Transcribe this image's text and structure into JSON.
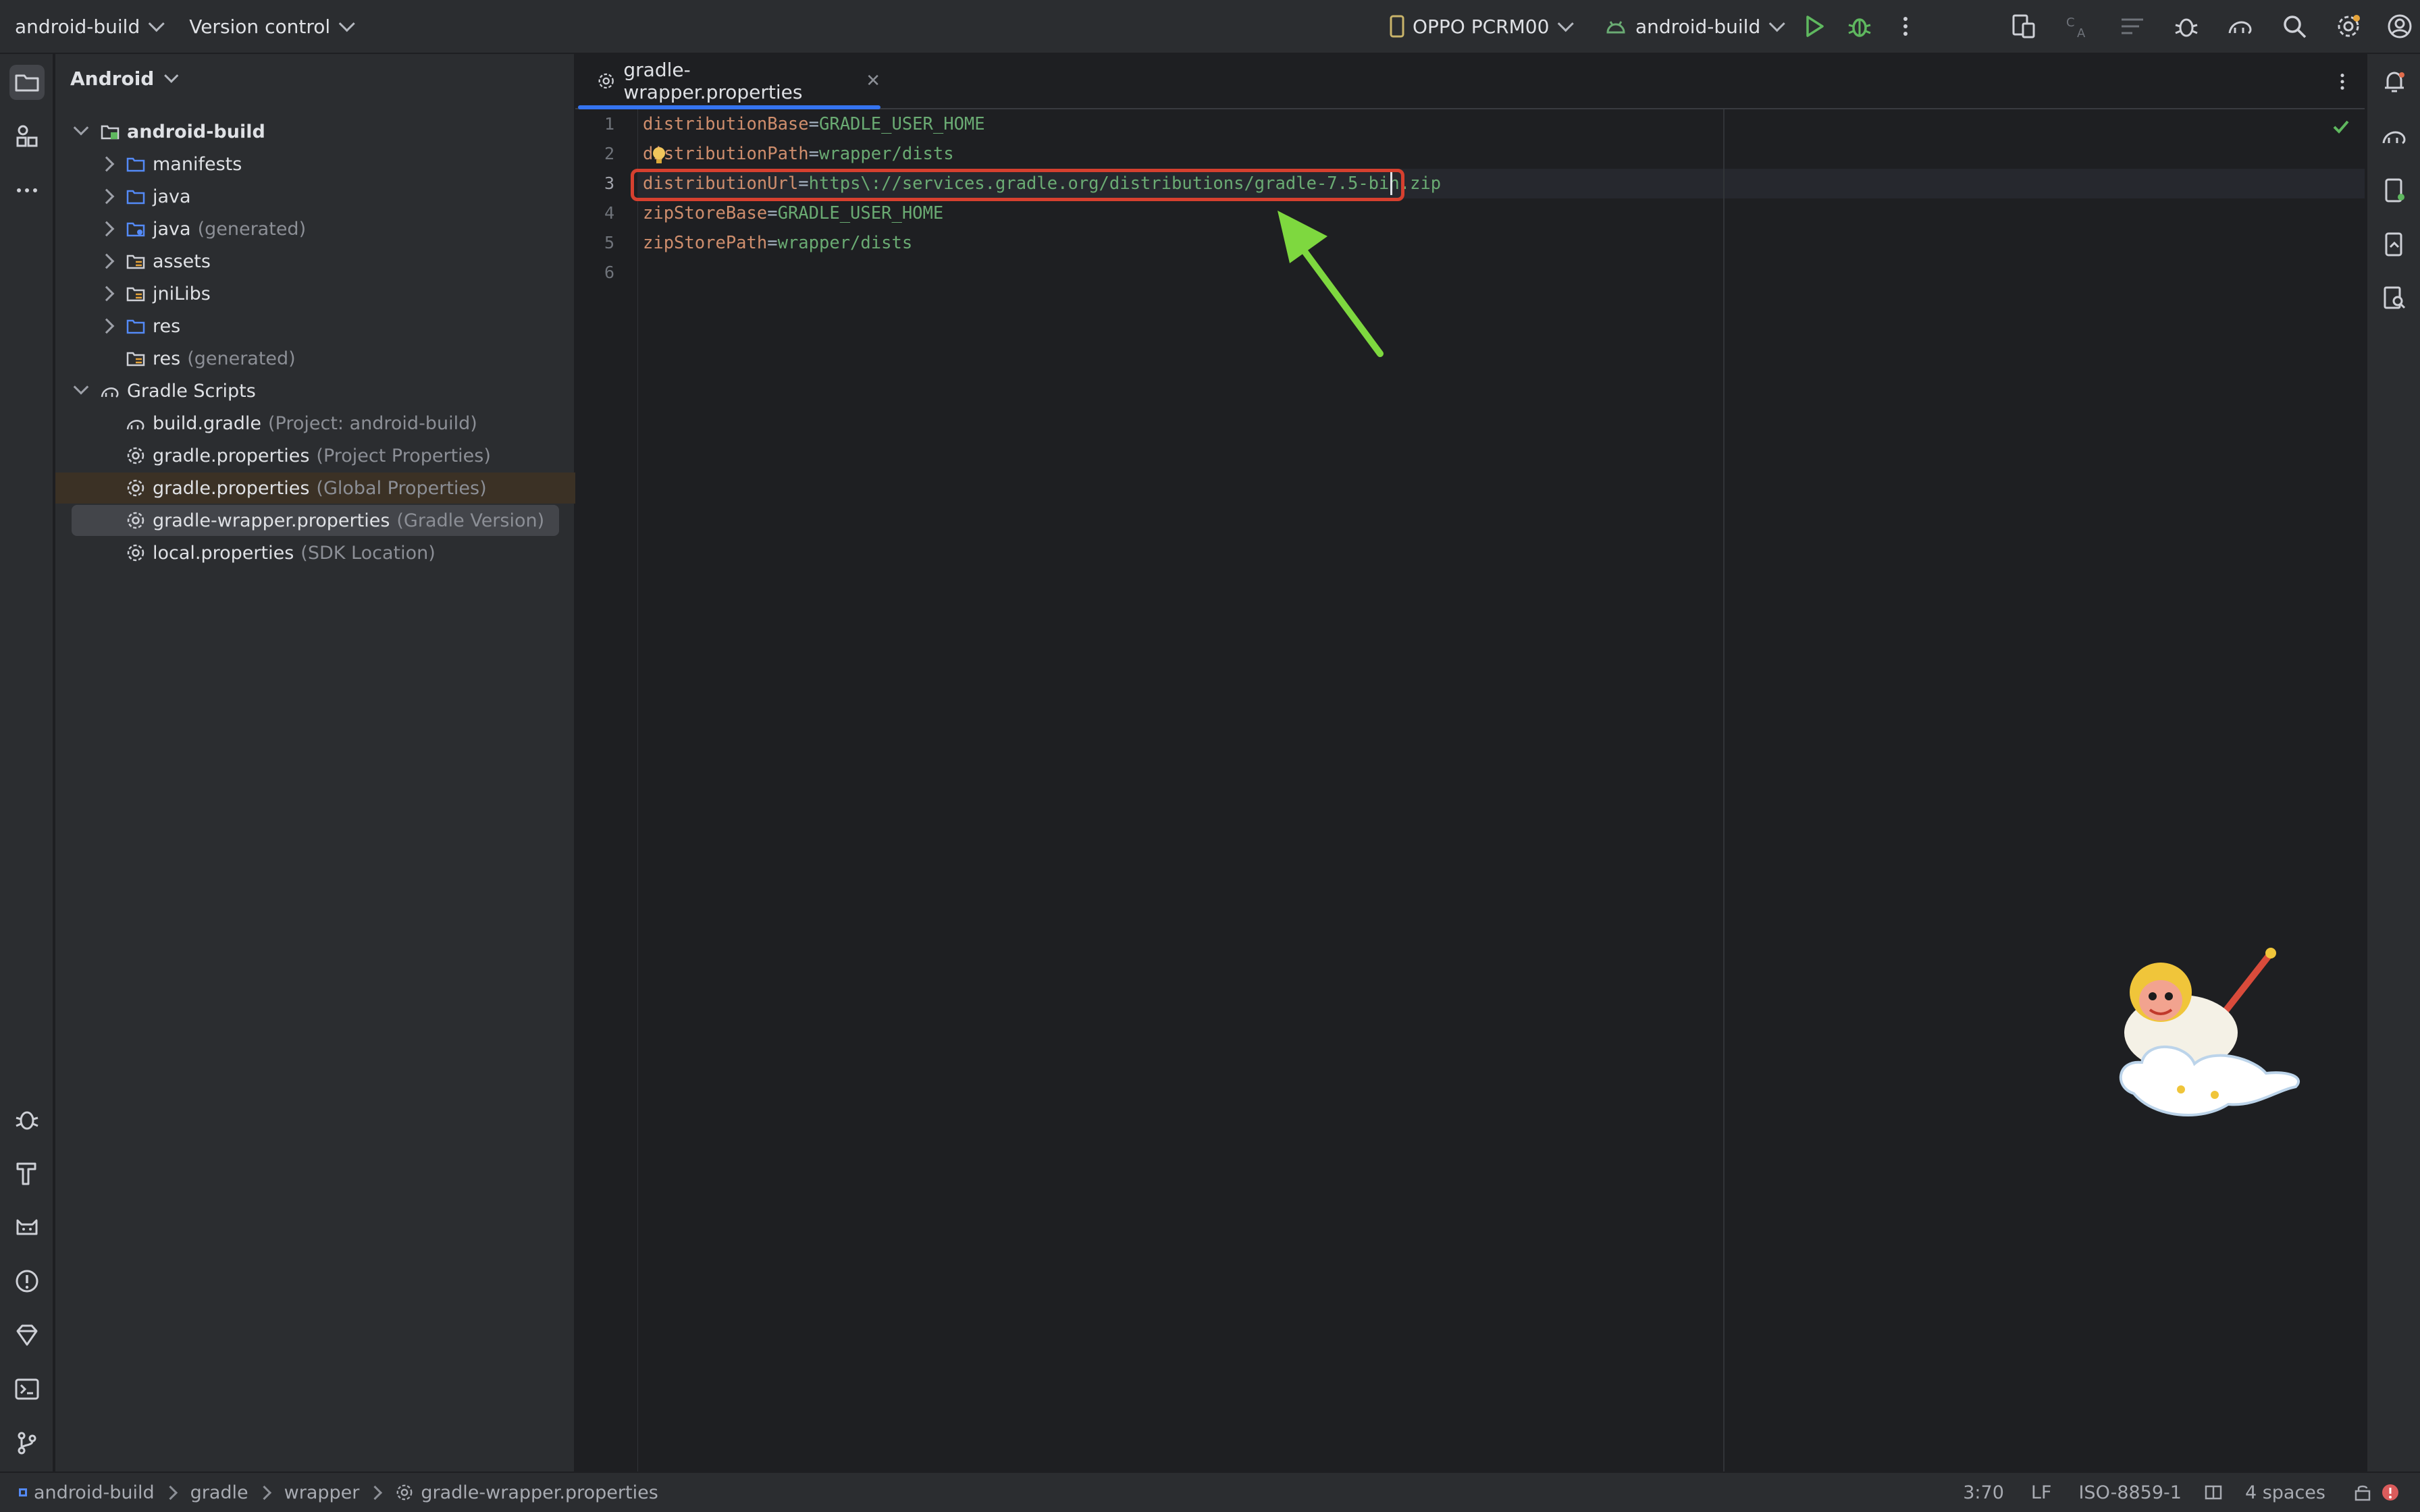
{
  "titlebar": {
    "project_name": "android-build",
    "vcs_label": "Version control",
    "device": "OPPO PCRM00",
    "run_config": "android-build"
  },
  "sidebar_title": "Android",
  "tree": {
    "root": "android-build",
    "manifests": "manifests",
    "java": "java",
    "java_gen": "java",
    "java_gen_hint": "(generated)",
    "assets": "assets",
    "jnilibs": "jniLibs",
    "res": "res",
    "res_gen": "res",
    "res_gen_hint": "(generated)",
    "gradle_scripts": "Gradle Scripts",
    "build_gradle": "build.gradle",
    "build_gradle_hint": "(Project: android-build)",
    "gradle_props_project": "gradle.properties",
    "gradle_props_project_hint": "(Project Properties)",
    "gradle_props_global": "gradle.properties",
    "gradle_props_global_hint": "(Global Properties)",
    "gradle_wrapper": "gradle-wrapper.properties",
    "gradle_wrapper_hint": "(Gradle Version)",
    "local_props": "local.properties",
    "local_props_hint": "(SDK Location)"
  },
  "editor": {
    "tab_label": "gradle-wrapper.properties",
    "lines": [
      {
        "num": "1",
        "key": "distributionBase",
        "eq": "=",
        "value": "GRADLE_USER_HOME"
      },
      {
        "num": "2",
        "key": "distributionPath",
        "eq": "=",
        "value": "wrapper/dists"
      },
      {
        "num": "3",
        "key": "distributionUrl",
        "eq": "=",
        "value": "https\\://services.gradle.org/distributions/gradle-7.5-bin.zip"
      },
      {
        "num": "4",
        "key": "zipStoreBase",
        "eq": "=",
        "value": "GRADLE_USER_HOME"
      },
      {
        "num": "5",
        "key": "zipStorePath",
        "eq": "=",
        "value": "wrapper/dists"
      },
      {
        "num": "6",
        "key": "",
        "eq": "",
        "value": ""
      }
    ]
  },
  "statusbar": {
    "crumbs": [
      "android-build",
      "gradle",
      "wrapper",
      "gradle-wrapper.properties"
    ],
    "position": "3:70",
    "line_sep": "LF",
    "encoding": "ISO-8859-1",
    "indent": "4 spaces"
  },
  "colors": {
    "accent": "#3574f0",
    "highlight_box": "#d6402f",
    "arrow": "#7ed83f",
    "key": "#cf8e6d",
    "value": "#6aab73"
  }
}
